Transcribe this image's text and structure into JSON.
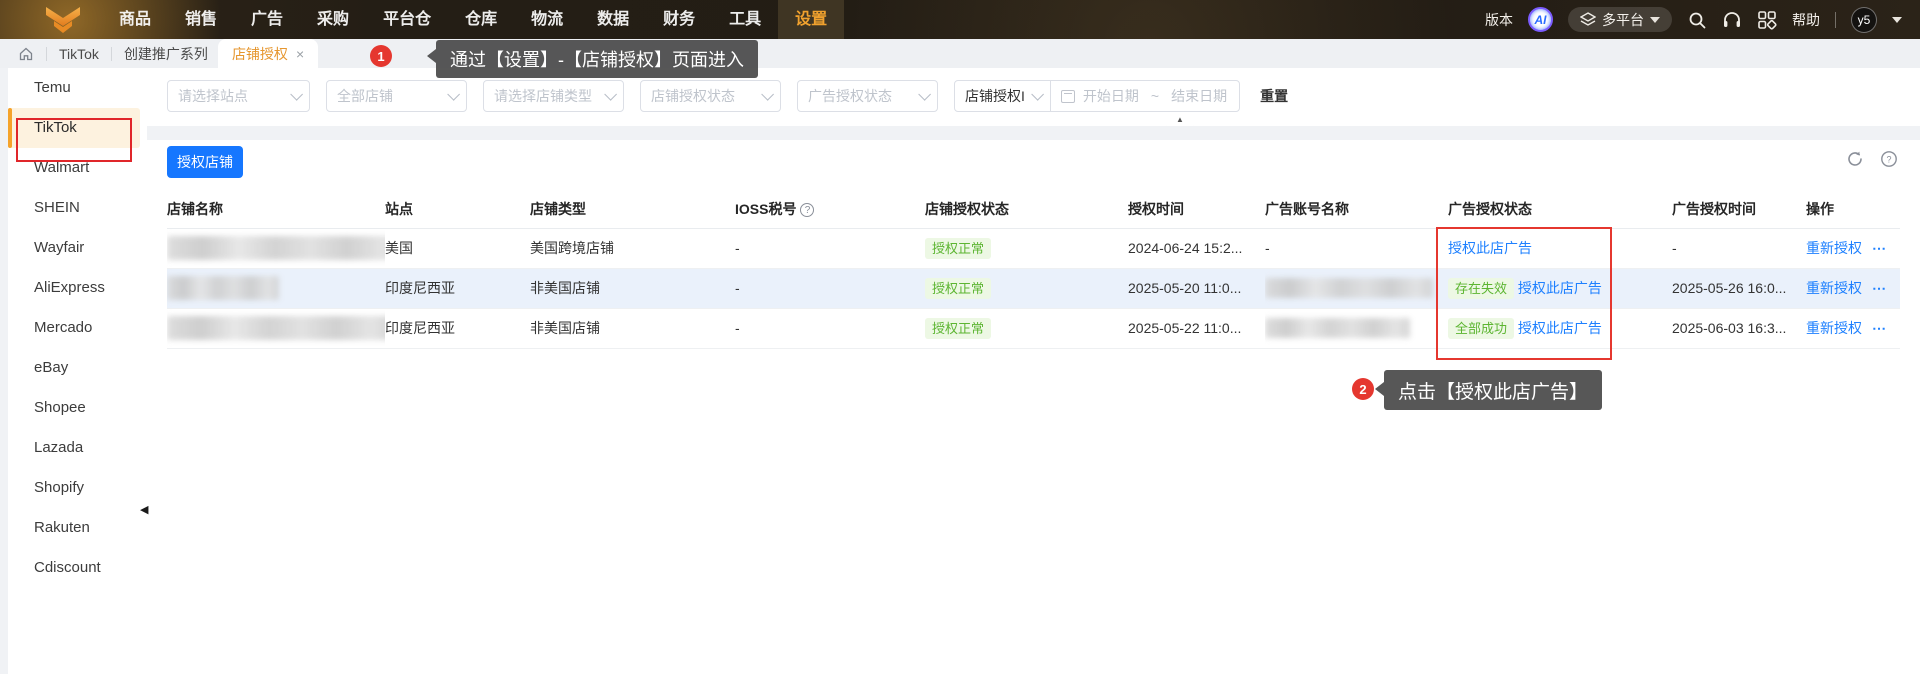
{
  "nav": {
    "items": [
      "商品",
      "销售",
      "广告",
      "采购",
      "平台仓",
      "仓库",
      "物流",
      "数据",
      "财务",
      "工具",
      "设置"
    ],
    "active_item": "设置",
    "version_label": "版本",
    "ai_badge": "AI",
    "platform_switcher": "多平台",
    "help_label": "帮助",
    "user_initials": "y5"
  },
  "tabbar": {
    "breadcrumb_platform": "TikTok",
    "breadcrumb_page": "创建推广系列",
    "active_tab": "店铺授权",
    "close_icon": "×"
  },
  "annotations": {
    "step1": {
      "badge": "1",
      "text": "通过【设置】-【店铺授权】页面进入"
    },
    "step2": {
      "badge": "2",
      "text": "点击【授权此店广告】"
    }
  },
  "sidebar": {
    "items": [
      {
        "label": "Temu"
      },
      {
        "label": "TikTok",
        "active": true
      },
      {
        "label": "Walmart"
      },
      {
        "label": "SHEIN"
      },
      {
        "label": "Wayfair"
      },
      {
        "label": "AliExpress"
      },
      {
        "label": "Mercado"
      },
      {
        "label": "eBay"
      },
      {
        "label": "Shopee"
      },
      {
        "label": "Lazada"
      },
      {
        "label": "Shopify"
      },
      {
        "label": "Rakuten"
      },
      {
        "label": "Cdiscount"
      }
    ]
  },
  "filters": {
    "site_placeholder": "请选择站点",
    "shop_value": "全部店铺",
    "shop_type_placeholder": "请选择店铺类型",
    "shop_auth_placeholder": "店铺授权状态",
    "ad_auth_placeholder": "广告授权状态",
    "date_type_value": "店铺授权I",
    "date_start_placeholder": "开始日期",
    "date_separator": "~",
    "date_end_placeholder": "结束日期",
    "reset_label": "重置"
  },
  "toolbar": {
    "authorize_button": "授权店铺"
  },
  "icons": {
    "more": "⋯",
    "collapse_up": "▲",
    "sidebar_collapse": "◀",
    "ioss_help": "?"
  },
  "table": {
    "columns": [
      "店铺名称",
      "站点",
      "店铺类型",
      "IOSS税号",
      "店铺授权状态",
      "授权时间",
      "广告账号名称",
      "广告授权状态",
      "广告授权时间",
      "操作"
    ],
    "rows": [
      {
        "site": "美国",
        "shop_type": "美国跨境店铺",
        "ioss": "-",
        "shop_auth_status": "授权正常",
        "auth_time": "2024-06-24 15:2...",
        "ad_account": "-",
        "ad_auth_link": "授权此店广告",
        "ad_auth_time": "-",
        "action_primary": "重新授权"
      },
      {
        "site": "印度尼西亚",
        "shop_type": "非美国店铺",
        "ioss": "-",
        "shop_auth_status": "授权正常",
        "auth_time": "2025-05-20 11:0...",
        "ad_status_tag": "存在失效",
        "ad_auth_link": "授权此店广告",
        "ad_auth_time": "2025-05-26 16:0...",
        "action_primary": "重新授权"
      },
      {
        "site": "印度尼西亚",
        "shop_type": "非美国店铺",
        "ioss": "-",
        "shop_auth_status": "授权正常",
        "auth_time": "2025-05-22 11:0...",
        "ad_status_tag": "全部成功",
        "ad_auth_link": "授权此店广告",
        "ad_auth_time": "2025-06-03 16:3...",
        "action_primary": "重新授权"
      }
    ]
  },
  "colors": {
    "accent_blue": "#1677ff",
    "link_blue": "#1e80ff",
    "success_green": "#5cb531",
    "success_bg": "#edf8e4",
    "annotation_red": "#e5372f",
    "nav_active_orange": "#f0a12e",
    "sidebar_active_bg": "#fdf2df"
  }
}
